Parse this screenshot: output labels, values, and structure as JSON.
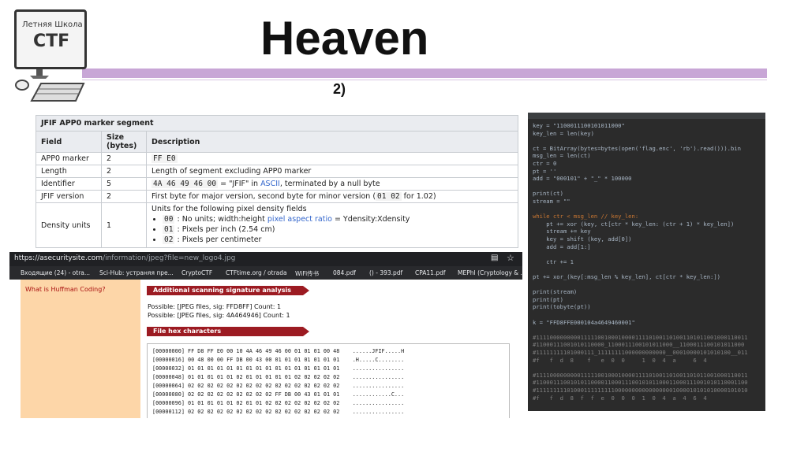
{
  "slide": {
    "title": "Heaven",
    "subtitle": "2)"
  },
  "logo": {
    "line1": "Летняя Школа",
    "line2": "CTF"
  },
  "jfif": {
    "caption": "JFIF APP0 marker segment",
    "headers": [
      "Field",
      "Size (bytes)",
      "Description"
    ],
    "rows": [
      {
        "field": "APP0 marker",
        "size": "2",
        "desc": "FF E0"
      },
      {
        "field": "Length",
        "size": "2",
        "desc": "Length of segment excluding APP0 marker"
      },
      {
        "field": "Identifier",
        "size": "5",
        "desc_code": "4A 46 49 46 00",
        "desc_mid": " = \"JFIF\" in ",
        "desc_link": "ASCII",
        "desc_tail": ", terminated by a null byte"
      },
      {
        "field": "JFIF version",
        "size": "2",
        "desc_a": "First byte for major version, second byte for minor version (",
        "desc_code": "01 02",
        "desc_b": " for 1.02)"
      },
      {
        "field": "Density units",
        "size": "1",
        "desc": "Units for the following pixel density fields",
        "bullets": [
          {
            "code": "00",
            "text": " : No units; width:height ",
            "link": "pixel aspect ratio",
            "tail": " = Ydensity:Xdensity"
          },
          {
            "code": "01",
            "text": " : Pixels per inch (2.54 cm)"
          },
          {
            "code": "02",
            "text": " : Pixels per centimeter"
          }
        ]
      }
    ]
  },
  "browser": {
    "url_host": "https://asecuritysite.com",
    "url_path": "/information/jpeg?file=new_logo4.jpg",
    "bookmarks": [
      {
        "label": "Входящие (24) - otra...",
        "color": "#ea4335"
      },
      {
        "label": "Sci-Hub: устраняя пре...",
        "color": "#d93025"
      },
      {
        "label": "CryptoCTF",
        "color": "#f29900"
      },
      {
        "label": "CTFtime.org / otrada",
        "color": "#e8710a"
      },
      {
        "label": "WiFi传书",
        "color": "#9aa0a6"
      },
      {
        "label": "084.pdf",
        "color": "#7b1fa2"
      },
      {
        "label": "() - 393.pdf",
        "color": "#7b1fa2"
      },
      {
        "label": "CPA11.pdf",
        "color": "#9aa0a6"
      },
      {
        "label": "MEPhI (Cryptology & ...",
        "color": "#1a73e8"
      }
    ],
    "left_question": "What is Huffman Coding?",
    "section1": "Additional scanning signature analysis",
    "possible1": "Possible: [JPEG files, sig: FFD8FF] Count: 1",
    "possible2": "Possible: [JPEG files, sig: 4A464946] Count: 1",
    "section2": "File hex characters",
    "hex_rows": [
      "[00000000] FF D8 FF E0 00 10 4A 46 49 46 00 01 01 01 00 48    ......JFIF.....H",
      "[00000016] 00 48 00 00 FF DB 00 43 00 01 01 01 01 01 01 01    .H.....C........",
      "[00000032] 01 01 01 01 01 01 01 01 01 01 01 01 01 01 01 01    ................",
      "[00000048] 01 01 01 01 01 02 01 01 01 01 01 02 02 02 02 02    ................",
      "[00000064] 02 02 02 02 02 02 02 02 02 02 02 02 02 02 02 02    ................",
      "[00000080] 02 02 02 02 02 02 02 02 02 FF DB 00 43 01 01 01    ............C...",
      "[00000096] 01 01 01 01 01 02 01 01 02 02 02 02 02 02 02 02    ................",
      "[00000112] 02 02 02 02 02 02 02 02 02 02 02 02 02 02 02 02    ................"
    ]
  },
  "editor": {
    "lines": [
      "key = \"1100011100101011000\"",
      "key_len = len(key)",
      "",
      "ct = BitArray(bytes=bytes(open('flag.enc', 'rb').read())).bin",
      "msg_len = len(ct)",
      "ctr = 0",
      "pt = ''",
      "add = \"000101\" + \"_\" * 100000",
      "",
      "print(ct)",
      "stream = \"\"",
      "",
      "while ctr < msg_len // key_len:",
      "    pt += xor (key, ct[ctr * key_len: (ctr + 1) * key_len])",
      "    stream += key",
      "    key = shift (key, add[0])",
      "    add = add[1:]",
      "",
      "    ctr += 1",
      "",
      "pt += xor_(key[:msg_len % key_len], ct[ctr * key_len:])",
      "",
      "print(stream)",
      "print(pt)",
      "print(tobyte(pt))",
      "",
      "k = \"FFD8FFE000104a4649460001\"",
      "",
      "#11110000000001111100100010000111101001101001101011001000110011",
      "#11000111001010110000_1100011100101011000__1100011100101011000",
      "#11111111101000111_11111111000000000000__00010000101010100__011",
      "#f   f  d  8    f   e  0  0     1  0  4  a     6  4",
      "",
      "#11110000000001111100100010000111101001101001101011001000110011",
      "#11000111001010110000110001110010101100011000111001010110001100",
      "#11111111101000111111111000000000000000001000010101010000101010",
      "#f   f  d  8  f  f  e  0  0  0  1  0  4  a  4  6  4"
    ]
  }
}
